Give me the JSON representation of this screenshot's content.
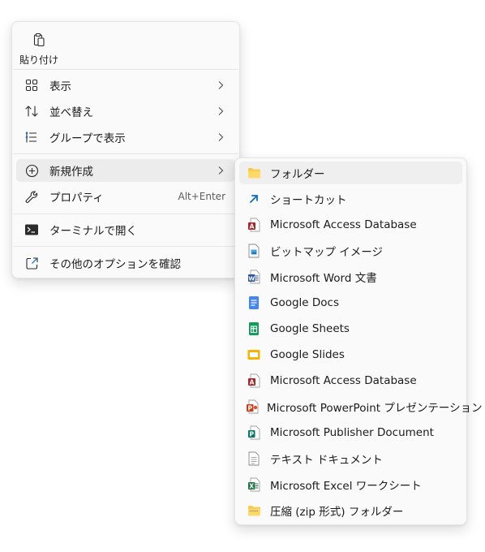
{
  "context_menu": {
    "paste": {
      "label": "貼り付け",
      "icon": "clipboard-icon"
    },
    "items": [
      {
        "label": "表示",
        "icon": "grid-icon",
        "has_submenu": true
      },
      {
        "label": "並べ替え",
        "icon": "sort-icon",
        "has_submenu": true
      },
      {
        "label": "グループで表示",
        "icon": "group-list-icon",
        "has_submenu": true
      },
      {
        "label": "新規作成",
        "icon": "plus-circle-icon",
        "has_submenu": true,
        "highlighted": true
      },
      {
        "label": "プロパティ",
        "icon": "wrench-icon",
        "shortcut": "Alt+Enter"
      },
      {
        "label": "ターミナルで開く",
        "icon": "terminal-icon"
      },
      {
        "label": "その他のオプションを確認",
        "icon": "open-external-icon"
      }
    ]
  },
  "new_submenu": {
    "items": [
      {
        "label": "フォルダー",
        "icon": "folder-icon",
        "highlighted": true
      },
      {
        "label": "ショートカット",
        "icon": "shortcut-arrow-icon"
      },
      {
        "label": "Microsoft Access Database",
        "icon": "access-file-icon"
      },
      {
        "label": "ビットマップ イメージ",
        "icon": "bitmap-file-icon"
      },
      {
        "label": "Microsoft Word 文書",
        "icon": "word-file-icon"
      },
      {
        "label": "Google Docs",
        "icon": "google-docs-icon"
      },
      {
        "label": "Google Sheets",
        "icon": "google-sheets-icon"
      },
      {
        "label": "Google Slides",
        "icon": "google-slides-icon"
      },
      {
        "label": "Microsoft Access Database",
        "icon": "access-file-icon"
      },
      {
        "label": "Microsoft PowerPoint プレゼンテーション",
        "icon": "powerpoint-file-icon"
      },
      {
        "label": "Microsoft Publisher Document",
        "icon": "publisher-file-icon"
      },
      {
        "label": "テキスト ドキュメント",
        "icon": "text-file-icon"
      },
      {
        "label": "Microsoft Excel ワークシート",
        "icon": "excel-file-icon"
      },
      {
        "label": "圧縮 (zip 形式) フォルダー",
        "icon": "zip-folder-icon"
      }
    ]
  },
  "colors": {
    "menu_bg": "#fafafa",
    "hover_bg": "#ececec",
    "accent": "#0067c0",
    "folder_yellow": "#f8c94a",
    "access_red": "#a4262c",
    "word_blue": "#2b579a",
    "excel_green": "#217346",
    "powerpoint_orange": "#c43e1c",
    "publisher_teal": "#077568",
    "google_docs_blue": "#4285f4",
    "google_sheets_green": "#0f9d58",
    "google_slides_yellow": "#f4b400"
  }
}
